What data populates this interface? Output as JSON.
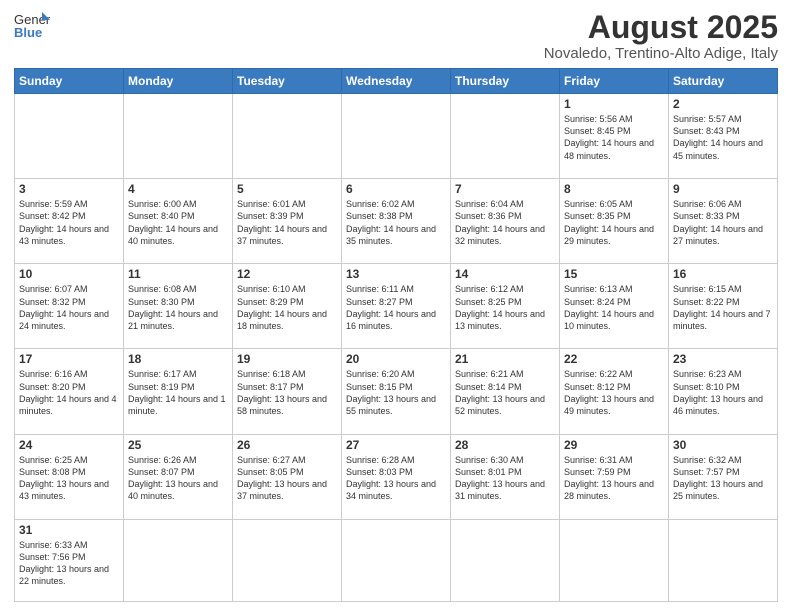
{
  "header": {
    "logo_general": "General",
    "logo_blue": "Blue",
    "title": "August 2025",
    "subtitle": "Novaledo, Trentino-Alto Adige, Italy"
  },
  "days_of_week": [
    "Sunday",
    "Monday",
    "Tuesday",
    "Wednesday",
    "Thursday",
    "Friday",
    "Saturday"
  ],
  "weeks": [
    [
      {
        "day": "",
        "info": ""
      },
      {
        "day": "",
        "info": ""
      },
      {
        "day": "",
        "info": ""
      },
      {
        "day": "",
        "info": ""
      },
      {
        "day": "",
        "info": ""
      },
      {
        "day": "1",
        "info": "Sunrise: 5:56 AM\nSunset: 8:45 PM\nDaylight: 14 hours and 48 minutes."
      },
      {
        "day": "2",
        "info": "Sunrise: 5:57 AM\nSunset: 8:43 PM\nDaylight: 14 hours and 45 minutes."
      }
    ],
    [
      {
        "day": "3",
        "info": "Sunrise: 5:59 AM\nSunset: 8:42 PM\nDaylight: 14 hours and 43 minutes."
      },
      {
        "day": "4",
        "info": "Sunrise: 6:00 AM\nSunset: 8:40 PM\nDaylight: 14 hours and 40 minutes."
      },
      {
        "day": "5",
        "info": "Sunrise: 6:01 AM\nSunset: 8:39 PM\nDaylight: 14 hours and 37 minutes."
      },
      {
        "day": "6",
        "info": "Sunrise: 6:02 AM\nSunset: 8:38 PM\nDaylight: 14 hours and 35 minutes."
      },
      {
        "day": "7",
        "info": "Sunrise: 6:04 AM\nSunset: 8:36 PM\nDaylight: 14 hours and 32 minutes."
      },
      {
        "day": "8",
        "info": "Sunrise: 6:05 AM\nSunset: 8:35 PM\nDaylight: 14 hours and 29 minutes."
      },
      {
        "day": "9",
        "info": "Sunrise: 6:06 AM\nSunset: 8:33 PM\nDaylight: 14 hours and 27 minutes."
      }
    ],
    [
      {
        "day": "10",
        "info": "Sunrise: 6:07 AM\nSunset: 8:32 PM\nDaylight: 14 hours and 24 minutes."
      },
      {
        "day": "11",
        "info": "Sunrise: 6:08 AM\nSunset: 8:30 PM\nDaylight: 14 hours and 21 minutes."
      },
      {
        "day": "12",
        "info": "Sunrise: 6:10 AM\nSunset: 8:29 PM\nDaylight: 14 hours and 18 minutes."
      },
      {
        "day": "13",
        "info": "Sunrise: 6:11 AM\nSunset: 8:27 PM\nDaylight: 14 hours and 16 minutes."
      },
      {
        "day": "14",
        "info": "Sunrise: 6:12 AM\nSunset: 8:25 PM\nDaylight: 14 hours and 13 minutes."
      },
      {
        "day": "15",
        "info": "Sunrise: 6:13 AM\nSunset: 8:24 PM\nDaylight: 14 hours and 10 minutes."
      },
      {
        "day": "16",
        "info": "Sunrise: 6:15 AM\nSunset: 8:22 PM\nDaylight: 14 hours and 7 minutes."
      }
    ],
    [
      {
        "day": "17",
        "info": "Sunrise: 6:16 AM\nSunset: 8:20 PM\nDaylight: 14 hours and 4 minutes."
      },
      {
        "day": "18",
        "info": "Sunrise: 6:17 AM\nSunset: 8:19 PM\nDaylight: 14 hours and 1 minute."
      },
      {
        "day": "19",
        "info": "Sunrise: 6:18 AM\nSunset: 8:17 PM\nDaylight: 13 hours and 58 minutes."
      },
      {
        "day": "20",
        "info": "Sunrise: 6:20 AM\nSunset: 8:15 PM\nDaylight: 13 hours and 55 minutes."
      },
      {
        "day": "21",
        "info": "Sunrise: 6:21 AM\nSunset: 8:14 PM\nDaylight: 13 hours and 52 minutes."
      },
      {
        "day": "22",
        "info": "Sunrise: 6:22 AM\nSunset: 8:12 PM\nDaylight: 13 hours and 49 minutes."
      },
      {
        "day": "23",
        "info": "Sunrise: 6:23 AM\nSunset: 8:10 PM\nDaylight: 13 hours and 46 minutes."
      }
    ],
    [
      {
        "day": "24",
        "info": "Sunrise: 6:25 AM\nSunset: 8:08 PM\nDaylight: 13 hours and 43 minutes."
      },
      {
        "day": "25",
        "info": "Sunrise: 6:26 AM\nSunset: 8:07 PM\nDaylight: 13 hours and 40 minutes."
      },
      {
        "day": "26",
        "info": "Sunrise: 6:27 AM\nSunset: 8:05 PM\nDaylight: 13 hours and 37 minutes."
      },
      {
        "day": "27",
        "info": "Sunrise: 6:28 AM\nSunset: 8:03 PM\nDaylight: 13 hours and 34 minutes."
      },
      {
        "day": "28",
        "info": "Sunrise: 6:30 AM\nSunset: 8:01 PM\nDaylight: 13 hours and 31 minutes."
      },
      {
        "day": "29",
        "info": "Sunrise: 6:31 AM\nSunset: 7:59 PM\nDaylight: 13 hours and 28 minutes."
      },
      {
        "day": "30",
        "info": "Sunrise: 6:32 AM\nSunset: 7:57 PM\nDaylight: 13 hours and 25 minutes."
      }
    ],
    [
      {
        "day": "31",
        "info": "Sunrise: 6:33 AM\nSunset: 7:56 PM\nDaylight: 13 hours and 22 minutes."
      },
      {
        "day": "",
        "info": ""
      },
      {
        "day": "",
        "info": ""
      },
      {
        "day": "",
        "info": ""
      },
      {
        "day": "",
        "info": ""
      },
      {
        "day": "",
        "info": ""
      },
      {
        "day": "",
        "info": ""
      }
    ]
  ]
}
